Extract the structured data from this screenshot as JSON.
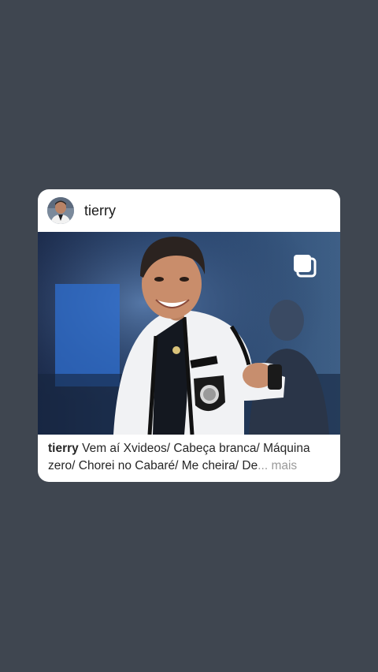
{
  "post": {
    "username": "tierry",
    "caption_user": "tierry",
    "caption_text": " Vem aí Xvideos/ Cabeça branca/ Máquina zero/ Chorei no Cabaré/ Me cheira/ De",
    "caption_more": "... mais",
    "avatar_icon": "profile-avatar",
    "carousel_icon": "multiple-photos-icon"
  },
  "colors": {
    "background": "#3f4650",
    "card": "#ffffff",
    "more_text": "#9a9a9a"
  }
}
